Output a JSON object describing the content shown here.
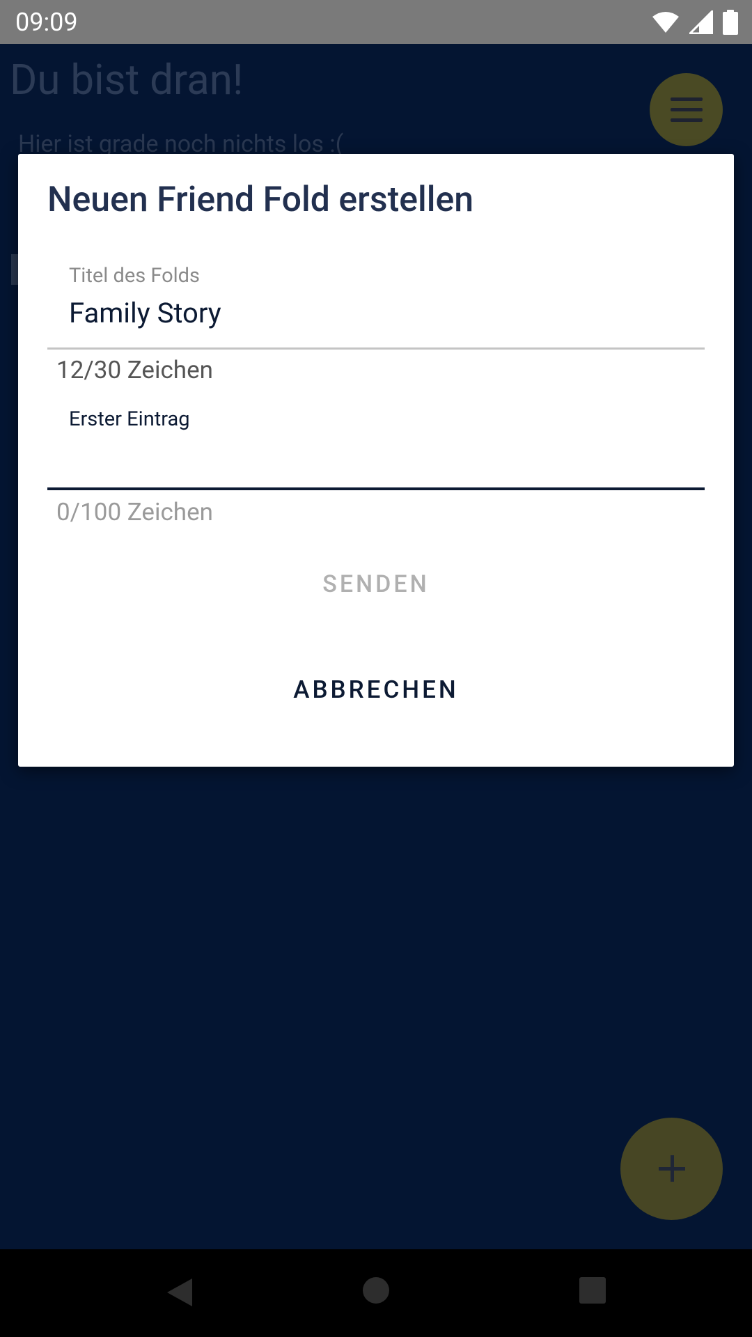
{
  "status_bar": {
    "time": "09:09",
    "icons": [
      "wifi-icon",
      "signal-icon",
      "battery-icon"
    ]
  },
  "background_screen": {
    "title": "Du bist dran!",
    "empty_message": "Hier ist grade noch nichts los :(",
    "menu_icon": "menu-icon",
    "fab_icon": "plus-icon"
  },
  "dialog": {
    "title": "Neuen Friend Fold erstellen",
    "title_field": {
      "label": "Titel des Folds",
      "value": "Family Story",
      "counter": "12/30 Zeichen"
    },
    "entry_field": {
      "placeholder": "Erster Eintrag",
      "value": "",
      "counter": "0/100 Zeichen"
    },
    "send_label": "SENDEN",
    "cancel_label": "ABBRECHEN"
  },
  "nav_bar": {
    "icons": [
      "back-icon",
      "home-icon",
      "recents-icon"
    ]
  },
  "colors": {
    "background": "#021330",
    "dialog_title": "#22304f",
    "accent_dark": "#0c1a33",
    "fab": "#474624",
    "disabled_text": "#b0b0b0"
  }
}
